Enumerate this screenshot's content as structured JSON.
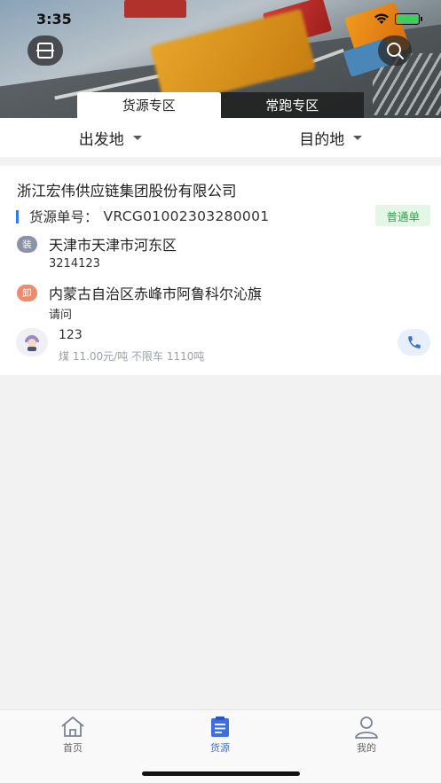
{
  "status_bar": {
    "time": "3:35"
  },
  "header": {
    "tabs": [
      {
        "label": "货源专区",
        "active": true
      },
      {
        "label": "常跑专区",
        "active": false
      }
    ],
    "icons": {
      "scan": "scan-icon",
      "search": "search-icon"
    }
  },
  "filter": {
    "origin_label": "出发地",
    "destination_label": "目的地"
  },
  "listing": {
    "company": "浙江宏伟供应链集团股份有限公司",
    "order_label": "货源单号：",
    "order_no": "VRCG01002303280001",
    "badge": "普通单",
    "load": {
      "tag": "装",
      "address": "天津市天津市河东区",
      "detail": "3214123"
    },
    "unload": {
      "tag": "卸",
      "address": "内蒙古自治区赤峰市阿鲁科尔沁旗",
      "detail": "请问"
    },
    "contact_name": "123",
    "cargo_info": "煤 11.00元/吨 不限车 1110吨"
  },
  "bottom_nav": [
    {
      "label": "首页",
      "icon": "home-icon",
      "active": false
    },
    {
      "label": "货源",
      "icon": "clipboard-icon",
      "active": true
    },
    {
      "label": "我的",
      "icon": "user-icon",
      "active": false
    }
  ],
  "colors": {
    "accent": "#3d6fe0",
    "order_bar": "#2f7bf0",
    "badge_bg": "#e4f6e6",
    "badge_text": "#2ea44f",
    "load_tag": "#8c93a8",
    "unload_tag": "#ef8a6c"
  }
}
